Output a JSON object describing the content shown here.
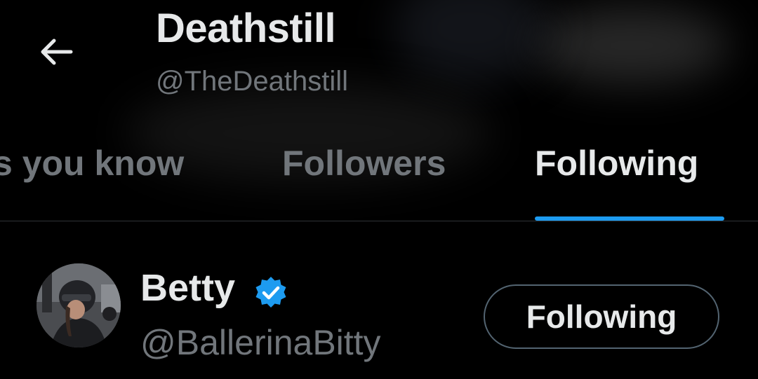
{
  "header": {
    "back_icon": "arrow-left-icon",
    "name": "Deathstill",
    "handle": "@TheDeathstill"
  },
  "tabs": [
    {
      "label": "s you know",
      "active": false
    },
    {
      "label": "Followers",
      "active": false
    },
    {
      "label": "Following",
      "active": true
    }
  ],
  "users": [
    {
      "name": "Betty",
      "verified": true,
      "handle": "@BallerinaBitty",
      "button_label": "Following"
    }
  ],
  "colors": {
    "background": "#000000",
    "primary_text": "#e7e9ea",
    "secondary_text": "#71767b",
    "accent": "#1d9bf0",
    "divider": "#2f3336",
    "button_border": "#536471"
  }
}
